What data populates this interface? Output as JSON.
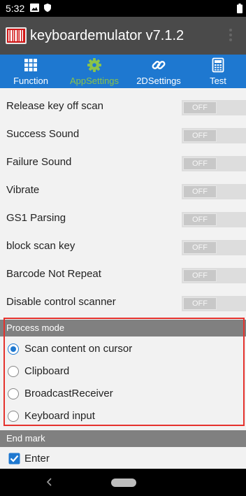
{
  "status_bar": {
    "time": "5:32",
    "icons": [
      "image-icon",
      "shield-icon",
      "battery-icon"
    ]
  },
  "app_bar": {
    "title": "keyboardemulator v7.1.2",
    "logo_icon": "barcode-logo-icon",
    "menu_icon": "overflow-menu-icon"
  },
  "tabs": [
    {
      "label": "Function",
      "icon": "grid-icon",
      "active": false
    },
    {
      "label": "AppSettings",
      "icon": "gear-icon",
      "active": true
    },
    {
      "label": "2DSettings",
      "icon": "link-icon",
      "active": false
    },
    {
      "label": "Test",
      "icon": "calculator-icon",
      "active": false
    }
  ],
  "settings": [
    {
      "label": "Release key off scan",
      "state": "OFF"
    },
    {
      "label": "Success Sound",
      "state": "OFF"
    },
    {
      "label": "Failure Sound",
      "state": "OFF"
    },
    {
      "label": "Vibrate",
      "state": "OFF"
    },
    {
      "label": "GS1 Parsing",
      "state": "OFF"
    },
    {
      "label": "block scan key",
      "state": "OFF"
    },
    {
      "label": "Barcode Not Repeat",
      "state": "OFF"
    },
    {
      "label": "Disable control scanner",
      "state": "OFF"
    }
  ],
  "process_mode": {
    "header": "Process mode",
    "options": [
      {
        "label": "Scan content on cursor",
        "selected": true
      },
      {
        "label": "Clipboard",
        "selected": false
      },
      {
        "label": "BroadcastReceiver",
        "selected": false
      },
      {
        "label": "Keyboard input",
        "selected": false
      }
    ]
  },
  "end_mark": {
    "header": "End mark",
    "option": {
      "label": "Enter",
      "checked": true
    }
  },
  "colors": {
    "tab_bar": "#1e78d0",
    "active_tab": "#8bc34a",
    "highlight_border": "#e5322d",
    "radio_checked": "#1e78d0"
  }
}
